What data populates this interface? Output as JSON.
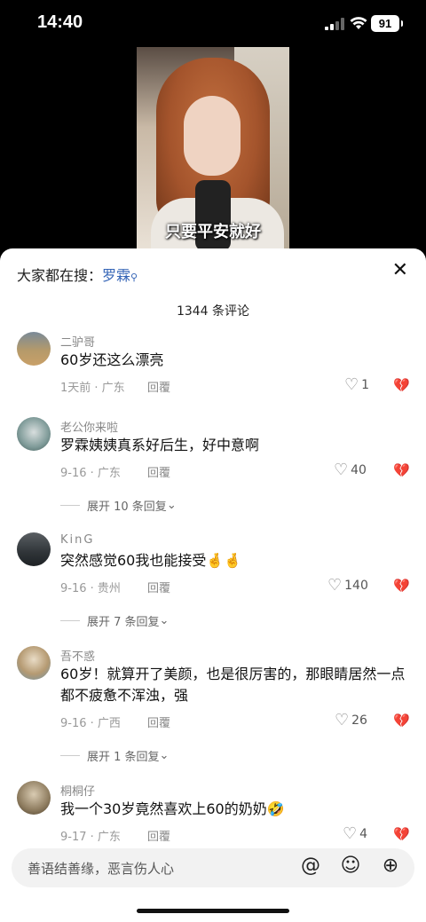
{
  "status": {
    "time": "14:40",
    "battery": "91"
  },
  "video": {
    "caption": "只要平安就好"
  },
  "panel": {
    "search_prefix": "大家都在搜：",
    "search_term": "罗霖",
    "count": "1344 条评论",
    "reply_label": "回覆"
  },
  "comments": [
    {
      "name": "二驴哥",
      "text": "60岁还这么漂亮",
      "meta": "1天前 · 广东",
      "likes": "1"
    },
    {
      "name": "老公你来啦",
      "text": "罗霖姨姨真系好后生，好中意啊",
      "meta": "9-16 · 广东",
      "likes": "40",
      "expand": "展开 10 条回复"
    },
    {
      "name": "KinG",
      "text": "突然感觉60我也能接受🤞🤞",
      "meta": "9-16 · 贵州",
      "likes": "140",
      "expand": "展开 7 条回复"
    },
    {
      "name": "吾不惑",
      "text": "60岁！就算开了美颜，也是很厉害的，那眼睛居然一点都不疲惫不浑浊，强",
      "meta": "9-16 · 广西",
      "likes": "26",
      "expand": "展开 1 条回复"
    },
    {
      "name": "桐桐仔",
      "text": "我一个30岁竟然喜欢上60的奶奶🤣",
      "meta": "9-17 · 广东",
      "likes": "4"
    }
  ],
  "input": {
    "placeholder": "善语结善缘，恶言伤人心"
  },
  "icons": [
    "signal-icon",
    "wifi-icon",
    "close-icon",
    "search-icon",
    "heart-icon",
    "dislike-icon",
    "chevron-down-icon",
    "at-icon",
    "emoji-icon",
    "plus-icon"
  ]
}
